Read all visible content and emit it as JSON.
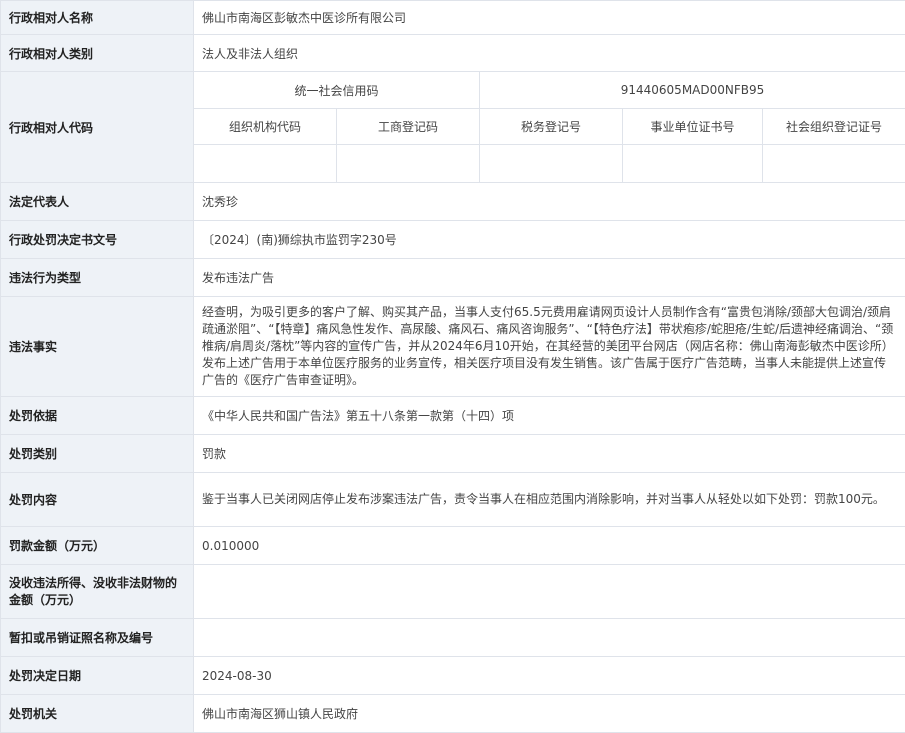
{
  "rows": {
    "name": {
      "label": "行政相对人名称",
      "value": "佛山市南海区彭敏杰中医诊所有限公司"
    },
    "category": {
      "label": "行政相对人类别",
      "value": "法人及非法人组织"
    },
    "code": {
      "label": "行政相对人代码",
      "credit_code_label": "统一社会信用码",
      "credit_code_value": "91440605MAD00NFB95",
      "sub_headers": [
        "组织机构代码",
        "工商登记码",
        "税务登记号",
        "事业单位证书号",
        "社会组织登记证号"
      ],
      "sub_values": [
        "",
        "",
        "",
        "",
        ""
      ]
    },
    "legal_rep": {
      "label": "法定代表人",
      "value": "沈秀珍"
    },
    "doc_no": {
      "label": "行政处罚决定书文号",
      "value": "〔2024〕(南)狮综执市监罚字230号"
    },
    "violation_type": {
      "label": "违法行为类型",
      "value": "发布违法广告"
    },
    "facts": {
      "label": "违法事实",
      "value": "经查明，为吸引更多的客户了解、购买其产品，当事人支付65.5元费用雇请网页设计人员制作含有“富贵包消除/颈部大包调治/颈肩疏通淤阻”、“【特章】痛风急性发作、高尿酸、痛风石、痛风咨询服务”、“【特色疗法】带状疱疹/蛇胆疮/生蛇/后遗神经痛调治、“颈椎病/肩周炎/落枕”等内容的宣传广告，并从2024年6月10开始，在其经营的美团平台网店（网店名称：佛山南海彭敏杰中医诊所）发布上述广告用于本单位医疗服务的业务宣传，相关医疗项目没有发生销售。该广告属于医疗广告范畴，当事人未能提供上述宣传广告的《医疗广告审查证明》。"
    },
    "basis": {
      "label": "处罚依据",
      "value": "《中华人民共和国广告法》第五十八条第一款第（十四）项"
    },
    "penalty_type": {
      "label": "处罚类别",
      "value": "罚款"
    },
    "content": {
      "label": "处罚内容",
      "value": "鉴于当事人已关闭网店停止发布涉案违法广告，责令当事人在相应范围内消除影响，并对当事人从轻处以如下处罚：罚款100元。"
    },
    "fine": {
      "label": "罚款金额（万元）",
      "value": "0.010000"
    },
    "confiscation": {
      "label": "没收违法所得、没收非法财物的金额（万元）",
      "value": ""
    },
    "license": {
      "label": "暂扣或吊销证照名称及编号",
      "value": ""
    },
    "decision_date": {
      "label": "处罚决定日期",
      "value": "2024-08-30"
    },
    "authority": {
      "label": "处罚机关",
      "value": "佛山市南海区狮山镇人民政府"
    }
  }
}
